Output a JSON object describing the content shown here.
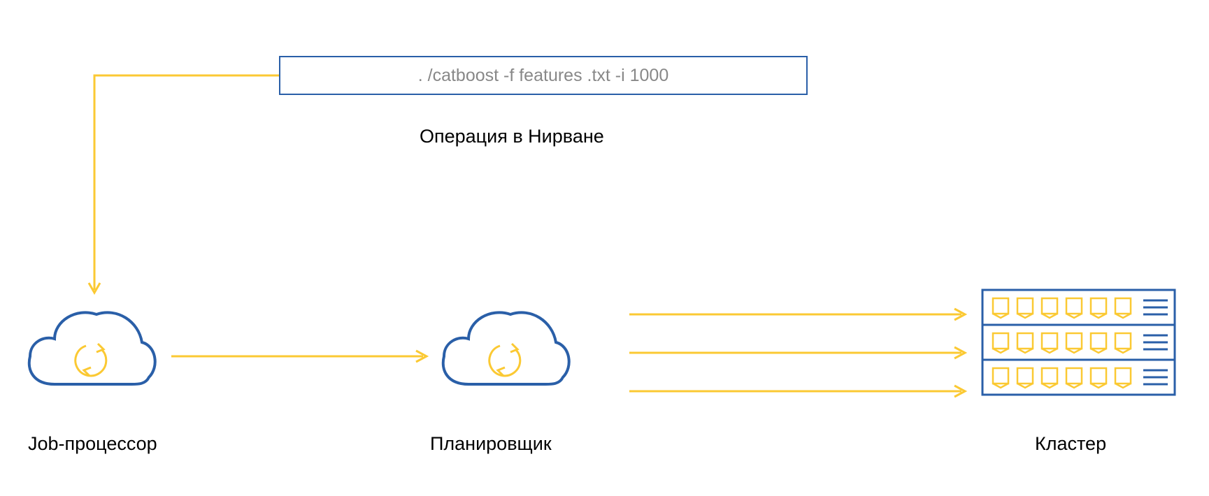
{
  "diagram": {
    "command_box_text": ". /catboost -f features .txt -i 1000",
    "operation_label": "Операция в Нирване",
    "nodes": {
      "job_processor": "Job-процессор",
      "scheduler": "Планировщик",
      "cluster": "Кластер"
    }
  },
  "colors": {
    "blue": "#2a5fa8",
    "yellow": "#fbc933",
    "grey": "#888888"
  }
}
